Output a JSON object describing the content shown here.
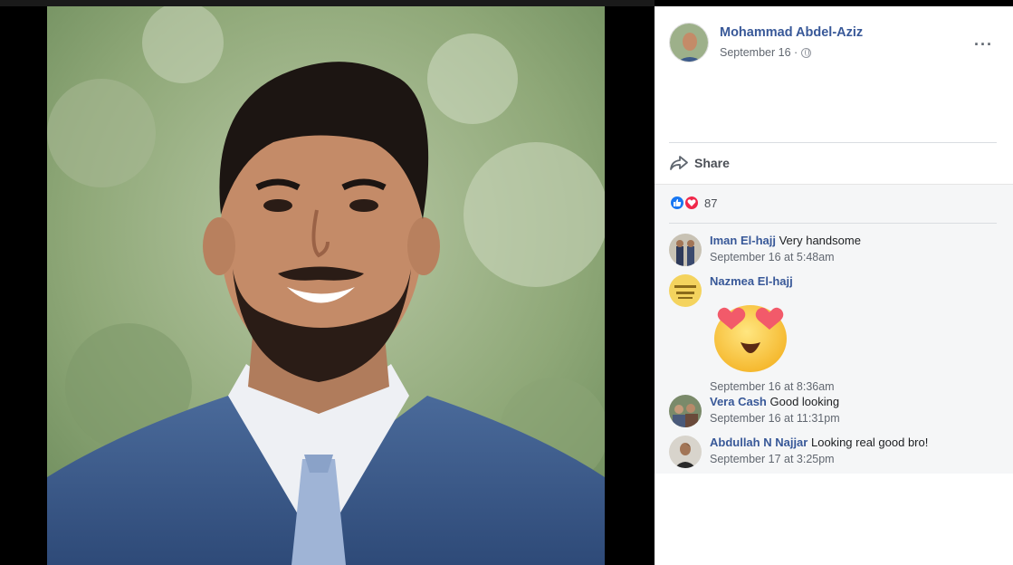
{
  "post": {
    "author": "Mohammad Abdel-Aziz",
    "date": "September 16 ·",
    "more_label": "···",
    "share_label": "Share"
  },
  "reactions": {
    "count": "87",
    "types": [
      "like-icon",
      "love-icon"
    ]
  },
  "comments": [
    {
      "name": "Iman El-hajj",
      "text": "Very handsome",
      "time": "September 16 at 5:48am"
    },
    {
      "name": "Nazmea El-hajj",
      "text": "",
      "time": "September 16 at 8:36am",
      "sticker": "heart-eyes-emoji"
    },
    {
      "name": "Vera Cash",
      "text": "Good looking",
      "time": "September 16 at 11:31pm"
    },
    {
      "name": "Abdullah N Najjar",
      "text": "Looking real good bro!",
      "time": "September 17 at 3:25pm"
    }
  ],
  "colors": {
    "link": "#385898",
    "like": "#1877f2",
    "love": "#f0284a",
    "comment_bg": "#f5f6f7"
  }
}
